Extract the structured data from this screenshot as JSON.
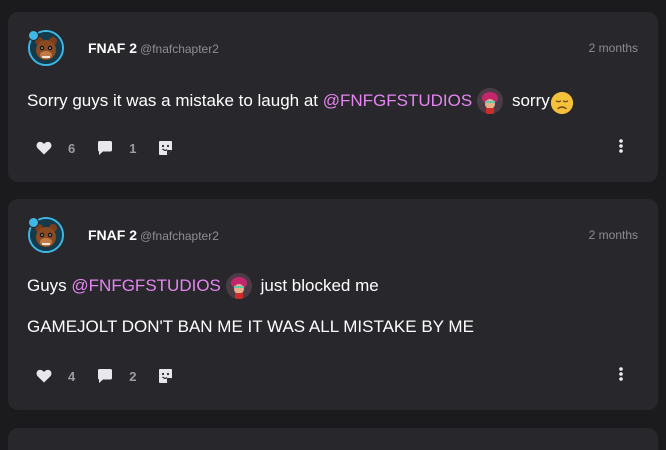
{
  "posts": [
    {
      "author": {
        "display_name": "FNAF 2",
        "handle": "@fnafchapter2"
      },
      "time": "2 months",
      "lines": [
        {
          "before": "Sorry guys it was a mistake to laugh at ",
          "mention": "@FNFGFSTUDIOS",
          "after": " sorry"
        }
      ],
      "likes": "6",
      "comments": "1"
    },
    {
      "author": {
        "display_name": "FNAF 2",
        "handle": "@fnafchapter2"
      },
      "time": "2 months",
      "lines": [
        {
          "before": "Guys ",
          "mention": "@FNFGFSTUDIOS",
          "after": " just blocked me"
        },
        {
          "text": "GAMEJOLT DON'T BAN ME IT WAS ALL MISTAKE BY ME"
        }
      ],
      "likes": "4",
      "comments": "2"
    }
  ],
  "colors": {
    "background": "#1b1a1d",
    "card": "#28272b",
    "mention": "#e585f2",
    "avatar_ring": "#3fb8e6"
  },
  "icons": [
    "heart-icon",
    "comment-icon",
    "sticker-icon",
    "more-options-icon",
    "disappointed-face-emoji"
  ]
}
